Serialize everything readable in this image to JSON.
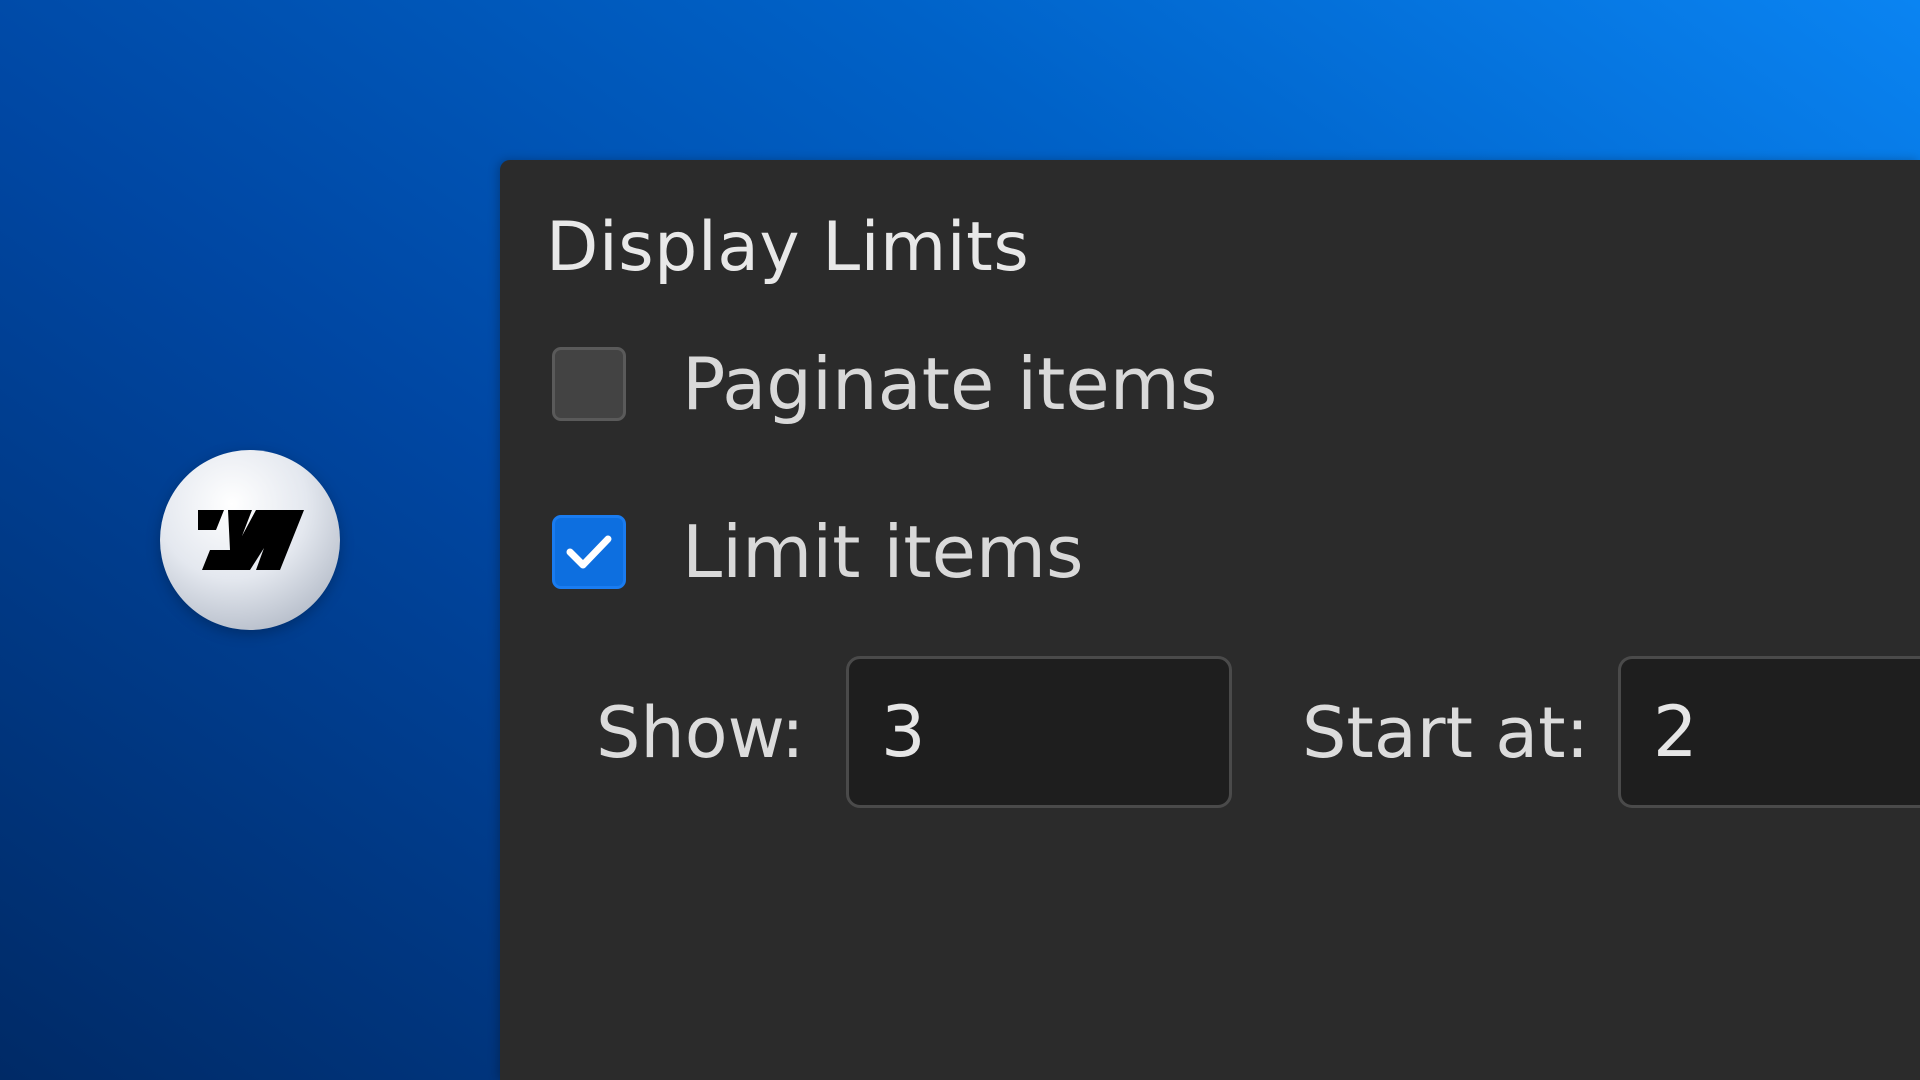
{
  "logo": {
    "icon": "webflow-logo-icon"
  },
  "panel": {
    "title": "Display Limits",
    "paginate": {
      "label": "Paginate items",
      "checked": false
    },
    "limit": {
      "label": "Limit items",
      "checked": true
    },
    "show": {
      "label": "Show:",
      "value": "3"
    },
    "start_at": {
      "label": "Start at:",
      "value": "2"
    }
  },
  "colors": {
    "accent": "#0d6fe0",
    "panel_bg": "#2b2b2b",
    "background_blue": "#0062c8"
  }
}
